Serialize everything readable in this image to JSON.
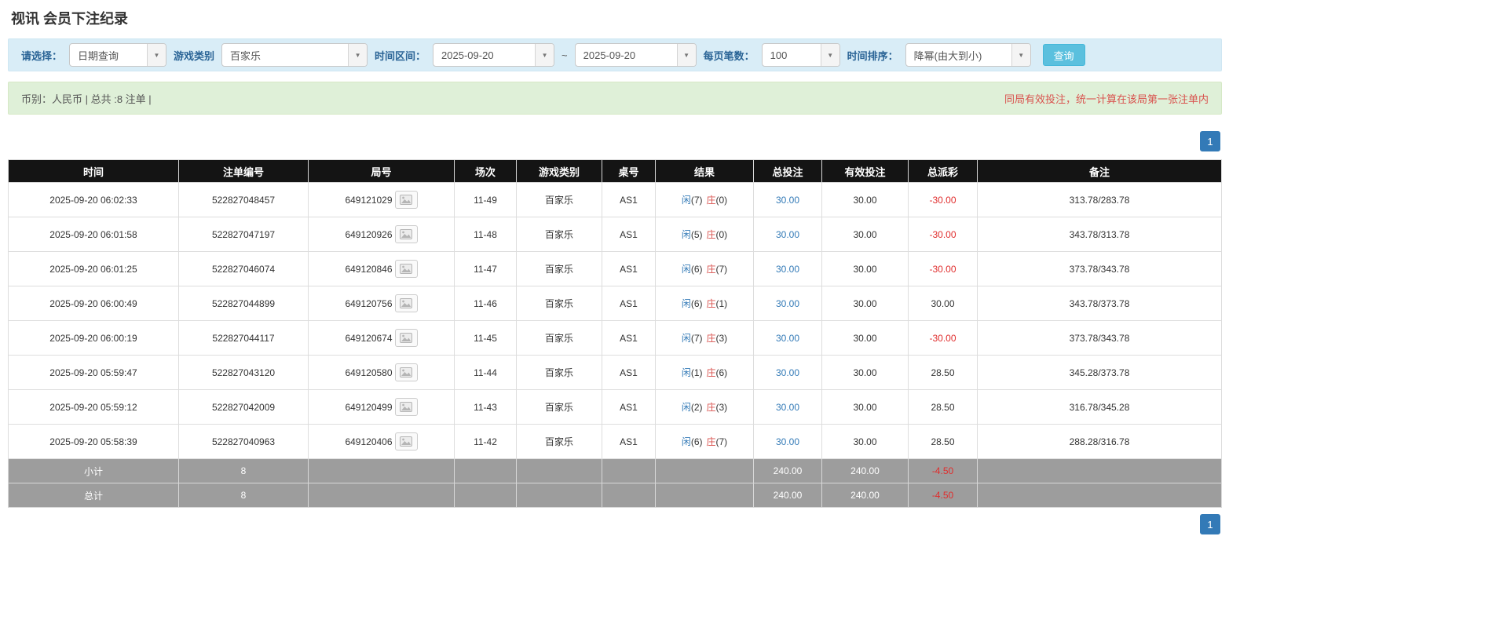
{
  "page": {
    "title": "视讯 会员下注纪录"
  },
  "colors": {
    "accent_blue": "#337ab7",
    "search_button": "#5bc0de",
    "filter_bar_bg": "#d9edf7",
    "notice_bar_bg": "#dff0d8",
    "table_header_bg": "#141414",
    "summary_row_bg": "#9d9d9d",
    "negative_red": "#e02d2d",
    "banker_red": "#d9534f",
    "player_blue": "#337ab7"
  },
  "filters": {
    "select_label": "请选择：",
    "select_value": "日期查询",
    "game_type_label": "游戏类别",
    "game_type_value": "百家乐",
    "time_range_label": "时间区间：",
    "date_from": "2025-09-20",
    "range_separator": "~",
    "date_to": "2025-09-20",
    "page_size_label": "每页笔数：",
    "page_size_value": "100",
    "sort_label": "时间排序：",
    "sort_value": "降幂(由大到小)",
    "search_button_label": "查询"
  },
  "notice": {
    "left": "币别：人民币 | 总共 :8 注单 |",
    "right": "同局有效投注，统一计算在该局第一张注单内"
  },
  "pagination": {
    "current_page": "1"
  },
  "table": {
    "headers": [
      "时间",
      "注单编号",
      "局号",
      "场次",
      "游戏类别",
      "桌号",
      "结果",
      "总投注",
      "有效投注",
      "总派彩",
      "备注"
    ],
    "rows": [
      {
        "time": "2025-09-20 06:02:33",
        "bet_id": "522827048457",
        "round_id": "649121029",
        "session": "11-49",
        "game": "百家乐",
        "table_no": "AS1",
        "player": "闲",
        "player_score": "(7)",
        "banker": "庄",
        "banker_score": "(0)",
        "total_bet": "30.00",
        "valid_bet": "30.00",
        "payout": "-30.00",
        "note": "313.78/283.78"
      },
      {
        "time": "2025-09-20 06:01:58",
        "bet_id": "522827047197",
        "round_id": "649120926",
        "session": "11-48",
        "game": "百家乐",
        "table_no": "AS1",
        "player": "闲",
        "player_score": "(5)",
        "banker": "庄",
        "banker_score": "(0)",
        "total_bet": "30.00",
        "valid_bet": "30.00",
        "payout": "-30.00",
        "note": "343.78/313.78"
      },
      {
        "time": "2025-09-20 06:01:25",
        "bet_id": "522827046074",
        "round_id": "649120846",
        "session": "11-47",
        "game": "百家乐",
        "table_no": "AS1",
        "player": "闲",
        "player_score": "(6)",
        "banker": "庄",
        "banker_score": "(7)",
        "total_bet": "30.00",
        "valid_bet": "30.00",
        "payout": "-30.00",
        "note": "373.78/343.78"
      },
      {
        "time": "2025-09-20 06:00:49",
        "bet_id": "522827044899",
        "round_id": "649120756",
        "session": "11-46",
        "game": "百家乐",
        "table_no": "AS1",
        "player": "闲",
        "player_score": "(6)",
        "banker": "庄",
        "banker_score": "(1)",
        "total_bet": "30.00",
        "valid_bet": "30.00",
        "payout": "30.00",
        "note": "343.78/373.78"
      },
      {
        "time": "2025-09-20 06:00:19",
        "bet_id": "522827044117",
        "round_id": "649120674",
        "session": "11-45",
        "game": "百家乐",
        "table_no": "AS1",
        "player": "闲",
        "player_score": "(7)",
        "banker": "庄",
        "banker_score": "(3)",
        "total_bet": "30.00",
        "valid_bet": "30.00",
        "payout": "-30.00",
        "note": "373.78/343.78"
      },
      {
        "time": "2025-09-20 05:59:47",
        "bet_id": "522827043120",
        "round_id": "649120580",
        "session": "11-44",
        "game": "百家乐",
        "table_no": "AS1",
        "player": "闲",
        "player_score": "(1)",
        "banker": "庄",
        "banker_score": "(6)",
        "total_bet": "30.00",
        "valid_bet": "30.00",
        "payout": "28.50",
        "note": "345.28/373.78"
      },
      {
        "time": "2025-09-20 05:59:12",
        "bet_id": "522827042009",
        "round_id": "649120499",
        "session": "11-43",
        "game": "百家乐",
        "table_no": "AS1",
        "player": "闲",
        "player_score": "(2)",
        "banker": "庄",
        "banker_score": "(3)",
        "total_bet": "30.00",
        "valid_bet": "30.00",
        "payout": "28.50",
        "note": "316.78/345.28"
      },
      {
        "time": "2025-09-20 05:58:39",
        "bet_id": "522827040963",
        "round_id": "649120406",
        "session": "11-42",
        "game": "百家乐",
        "table_no": "AS1",
        "player": "闲",
        "player_score": "(6)",
        "banker": "庄",
        "banker_score": "(7)",
        "total_bet": "30.00",
        "valid_bet": "30.00",
        "payout": "28.50",
        "note": "288.28/316.78"
      }
    ],
    "subtotal_row": {
      "label": "小计",
      "count": "8",
      "total_bet": "240.00",
      "valid_bet": "240.00",
      "payout": "-4.50"
    },
    "total_row": {
      "label": "总计",
      "count": "8",
      "total_bet": "240.00",
      "valid_bet": "240.00",
      "payout": "-4.50"
    }
  }
}
